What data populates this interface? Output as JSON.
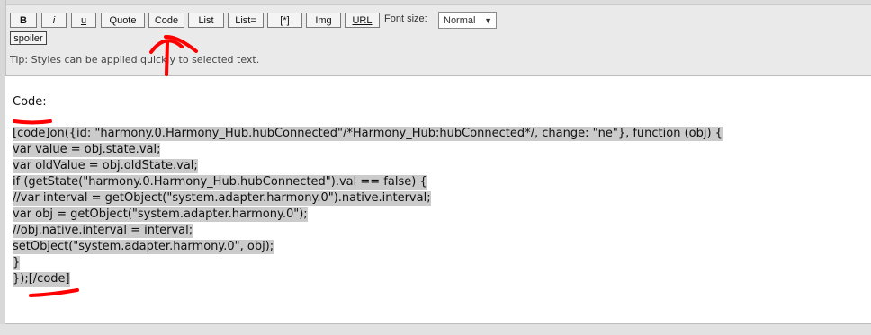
{
  "toolbar": {
    "buttons": [
      "B",
      "i",
      "u",
      "Quote",
      "Code",
      "List",
      "List=",
      "[*]",
      "Img",
      "URL"
    ],
    "font_size_label": "Font size:",
    "font_size_value": "Normal",
    "spoiler_label": "spoiler"
  },
  "tip": "Tip: Styles can be applied quickly to selected text.",
  "editor": {
    "heading": "Code:",
    "lines": [
      "[code]on({id: \"harmony.0.Harmony_Hub.hubConnected\"/*Harmony_Hub:hubConnected*/, change: \"ne\"}, function (obj) {",
      "var value = obj.state.val;",
      "var oldValue = obj.oldState.val;",
      "if (getState(\"harmony.0.Harmony_Hub.hubConnected\").val == false) {",
      "//var interval = getObject(\"system.adapter.harmony.0\").native.interval;",
      "var obj = getObject(\"system.adapter.harmony.0\");",
      "//obj.native.interval = interval;",
      "setObject(\"system.adapter.harmony.0\", obj);",
      "}",
      "});[/code]"
    ]
  },
  "colors": {
    "annotation": "#ff0000",
    "selection": "#cbcbcb"
  }
}
